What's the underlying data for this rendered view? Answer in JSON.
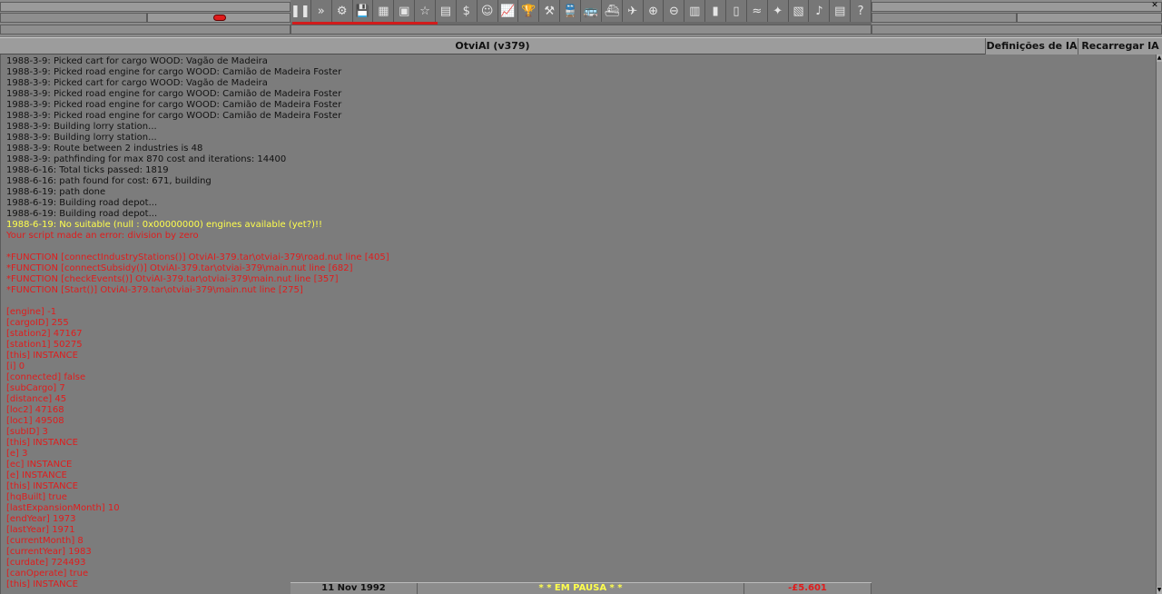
{
  "toolbar": {
    "icons": [
      "pause-icon",
      "fast-forward-icon",
      "settings-icon",
      "save-icon",
      "minimap-icon",
      "town-icon",
      "subsidies-icon",
      "stations-icon",
      "finances-icon",
      "company-icon",
      "graph-icon",
      "league-icon",
      "industry-icon",
      "trains-icon",
      "road-vehicles-icon",
      "ships-icon",
      "aircraft-icon",
      "zoom-in-icon",
      "zoom-out-icon",
      "build-rail-icon",
      "build-road-icon",
      "build-tram-icon",
      "build-water-icon",
      "build-air-icon",
      "landscape-icon",
      "music-icon",
      "news-icon",
      "help-icon"
    ],
    "glyphs": [
      "❚❚",
      "»",
      "⚙",
      "💾",
      "▦",
      "▣",
      "☆",
      "▤",
      "$",
      "☺",
      "📈",
      "🏆",
      "⚒",
      "🚆",
      "🚌",
      "⛴",
      "✈",
      "⊕",
      "⊖",
      "▥",
      "▮",
      "▯",
      "≈",
      "✦",
      "▧",
      "♪",
      "▤",
      "?"
    ]
  },
  "window": {
    "title": "OtviAI (v379)",
    "settings_button": "Definições de IA",
    "reload_button": "Recarregar IA"
  },
  "log_lines": [
    {
      "text": "1988-3-9: Picked cart for cargo WOOD: Vagão de Madeira",
      "color": "black"
    },
    {
      "text": "1988-3-9: Picked road engine for cargo WOOD: Camião de Madeira Foster",
      "color": "black"
    },
    {
      "text": "1988-3-9: Picked cart for cargo WOOD: Vagão de Madeira",
      "color": "black"
    },
    {
      "text": "1988-3-9: Picked road engine for cargo WOOD: Camião de Madeira Foster",
      "color": "black"
    },
    {
      "text": "1988-3-9: Picked road engine for cargo WOOD: Camião de Madeira Foster",
      "color": "black"
    },
    {
      "text": "1988-3-9: Picked road engine for cargo WOOD: Camião de Madeira Foster",
      "color": "black"
    },
    {
      "text": "1988-3-9: Building lorry station...",
      "color": "black"
    },
    {
      "text": "1988-3-9: Building lorry station...",
      "color": "black"
    },
    {
      "text": "1988-3-9: Route between 2 industries is 48",
      "color": "black"
    },
    {
      "text": "1988-3-9: pathfinding for max 870 cost and iterations: 14400",
      "color": "black"
    },
    {
      "text": "1988-6-16: Total ticks passed: 1819",
      "color": "black"
    },
    {
      "text": "1988-6-16: path found for cost: 671, building",
      "color": "black"
    },
    {
      "text": "1988-6-19: path done",
      "color": "black"
    },
    {
      "text": "1988-6-19: Building road depot...",
      "color": "black"
    },
    {
      "text": "1988-6-19: Building road depot...",
      "color": "black"
    },
    {
      "text": "1988-6-19: No suitable (null : 0x00000000) engines available (yet?)!!",
      "color": "yellow"
    },
    {
      "text": "Your script made an error: division by zero",
      "color": "red"
    },
    {
      "text": "",
      "color": "red"
    },
    {
      "text": "*FUNCTION [connectIndustryStations()] OtviAI-379.tar\\otviai-379\\road.nut line [405]",
      "color": "red"
    },
    {
      "text": "*FUNCTION [connectSubsidy()] OtviAI-379.tar\\otviai-379\\main.nut line [682]",
      "color": "red"
    },
    {
      "text": "*FUNCTION [checkEvents()] OtviAI-379.tar\\otviai-379\\main.nut line [357]",
      "color": "red"
    },
    {
      "text": "*FUNCTION [Start()] OtviAI-379.tar\\otviai-379\\main.nut line [275]",
      "color": "red"
    },
    {
      "text": "",
      "color": "red"
    },
    {
      "text": "[engine] -1",
      "color": "red"
    },
    {
      "text": "[cargoID] 255",
      "color": "red"
    },
    {
      "text": "[station2] 47167",
      "color": "red"
    },
    {
      "text": "[station1] 50275",
      "color": "red"
    },
    {
      "text": "[this] INSTANCE",
      "color": "red"
    },
    {
      "text": "[i] 0",
      "color": "red"
    },
    {
      "text": "[connected] false",
      "color": "red"
    },
    {
      "text": "[subCargo] 7",
      "color": "red"
    },
    {
      "text": "[distance] 45",
      "color": "red"
    },
    {
      "text": "[loc2] 47168",
      "color": "red"
    },
    {
      "text": "[loc1] 49508",
      "color": "red"
    },
    {
      "text": "[subID] 3",
      "color": "red"
    },
    {
      "text": "[this] INSTANCE",
      "color": "red"
    },
    {
      "text": "[e] 3",
      "color": "red"
    },
    {
      "text": "[ec] INSTANCE",
      "color": "red"
    },
    {
      "text": "[e] INSTANCE",
      "color": "red"
    },
    {
      "text": "[this] INSTANCE",
      "color": "red"
    },
    {
      "text": "[hqBuilt] true",
      "color": "red"
    },
    {
      "text": "[lastExpansionMonth] 10",
      "color": "red"
    },
    {
      "text": "[endYear] 1973",
      "color": "red"
    },
    {
      "text": "[lastYear] 1971",
      "color": "red"
    },
    {
      "text": "[currentMonth] 8",
      "color": "red"
    },
    {
      "text": "[currentYear] 1983",
      "color": "red"
    },
    {
      "text": "[curdate] 724493",
      "color": "red"
    },
    {
      "text": "[canOperate] true",
      "color": "red"
    },
    {
      "text": "[this] INSTANCE",
      "color": "red"
    }
  ],
  "status": {
    "date": "11 Nov 1992",
    "news": "* * EM PAUSA * *",
    "money": "-£5.601"
  },
  "colors": {
    "log_text": "#111111",
    "log_warning": "#ffff4c",
    "log_error": "#e01c1c",
    "background": "#7c7c7c"
  }
}
